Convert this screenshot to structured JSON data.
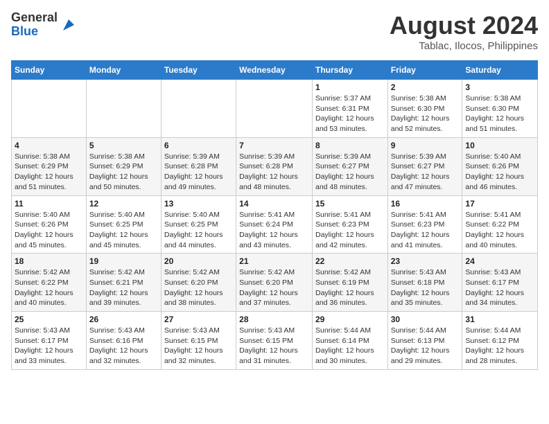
{
  "header": {
    "logo_general": "General",
    "logo_blue": "Blue",
    "month_title": "August 2024",
    "location": "Tablac, Ilocos, Philippines"
  },
  "days_of_week": [
    "Sunday",
    "Monday",
    "Tuesday",
    "Wednesday",
    "Thursday",
    "Friday",
    "Saturday"
  ],
  "weeks": [
    [
      {
        "day": "",
        "info": ""
      },
      {
        "day": "",
        "info": ""
      },
      {
        "day": "",
        "info": ""
      },
      {
        "day": "",
        "info": ""
      },
      {
        "day": "1",
        "info": "Sunrise: 5:37 AM\nSunset: 6:31 PM\nDaylight: 12 hours\nand 53 minutes."
      },
      {
        "day": "2",
        "info": "Sunrise: 5:38 AM\nSunset: 6:30 PM\nDaylight: 12 hours\nand 52 minutes."
      },
      {
        "day": "3",
        "info": "Sunrise: 5:38 AM\nSunset: 6:30 PM\nDaylight: 12 hours\nand 51 minutes."
      }
    ],
    [
      {
        "day": "4",
        "info": "Sunrise: 5:38 AM\nSunset: 6:29 PM\nDaylight: 12 hours\nand 51 minutes."
      },
      {
        "day": "5",
        "info": "Sunrise: 5:38 AM\nSunset: 6:29 PM\nDaylight: 12 hours\nand 50 minutes."
      },
      {
        "day": "6",
        "info": "Sunrise: 5:39 AM\nSunset: 6:28 PM\nDaylight: 12 hours\nand 49 minutes."
      },
      {
        "day": "7",
        "info": "Sunrise: 5:39 AM\nSunset: 6:28 PM\nDaylight: 12 hours\nand 48 minutes."
      },
      {
        "day": "8",
        "info": "Sunrise: 5:39 AM\nSunset: 6:27 PM\nDaylight: 12 hours\nand 48 minutes."
      },
      {
        "day": "9",
        "info": "Sunrise: 5:39 AM\nSunset: 6:27 PM\nDaylight: 12 hours\nand 47 minutes."
      },
      {
        "day": "10",
        "info": "Sunrise: 5:40 AM\nSunset: 6:26 PM\nDaylight: 12 hours\nand 46 minutes."
      }
    ],
    [
      {
        "day": "11",
        "info": "Sunrise: 5:40 AM\nSunset: 6:26 PM\nDaylight: 12 hours\nand 45 minutes."
      },
      {
        "day": "12",
        "info": "Sunrise: 5:40 AM\nSunset: 6:25 PM\nDaylight: 12 hours\nand 45 minutes."
      },
      {
        "day": "13",
        "info": "Sunrise: 5:40 AM\nSunset: 6:25 PM\nDaylight: 12 hours\nand 44 minutes."
      },
      {
        "day": "14",
        "info": "Sunrise: 5:41 AM\nSunset: 6:24 PM\nDaylight: 12 hours\nand 43 minutes."
      },
      {
        "day": "15",
        "info": "Sunrise: 5:41 AM\nSunset: 6:23 PM\nDaylight: 12 hours\nand 42 minutes."
      },
      {
        "day": "16",
        "info": "Sunrise: 5:41 AM\nSunset: 6:23 PM\nDaylight: 12 hours\nand 41 minutes."
      },
      {
        "day": "17",
        "info": "Sunrise: 5:41 AM\nSunset: 6:22 PM\nDaylight: 12 hours\nand 40 minutes."
      }
    ],
    [
      {
        "day": "18",
        "info": "Sunrise: 5:42 AM\nSunset: 6:22 PM\nDaylight: 12 hours\nand 40 minutes."
      },
      {
        "day": "19",
        "info": "Sunrise: 5:42 AM\nSunset: 6:21 PM\nDaylight: 12 hours\nand 39 minutes."
      },
      {
        "day": "20",
        "info": "Sunrise: 5:42 AM\nSunset: 6:20 PM\nDaylight: 12 hours\nand 38 minutes."
      },
      {
        "day": "21",
        "info": "Sunrise: 5:42 AM\nSunset: 6:20 PM\nDaylight: 12 hours\nand 37 minutes."
      },
      {
        "day": "22",
        "info": "Sunrise: 5:42 AM\nSunset: 6:19 PM\nDaylight: 12 hours\nand 36 minutes."
      },
      {
        "day": "23",
        "info": "Sunrise: 5:43 AM\nSunset: 6:18 PM\nDaylight: 12 hours\nand 35 minutes."
      },
      {
        "day": "24",
        "info": "Sunrise: 5:43 AM\nSunset: 6:17 PM\nDaylight: 12 hours\nand 34 minutes."
      }
    ],
    [
      {
        "day": "25",
        "info": "Sunrise: 5:43 AM\nSunset: 6:17 PM\nDaylight: 12 hours\nand 33 minutes."
      },
      {
        "day": "26",
        "info": "Sunrise: 5:43 AM\nSunset: 6:16 PM\nDaylight: 12 hours\nand 32 minutes."
      },
      {
        "day": "27",
        "info": "Sunrise: 5:43 AM\nSunset: 6:15 PM\nDaylight: 12 hours\nand 32 minutes."
      },
      {
        "day": "28",
        "info": "Sunrise: 5:43 AM\nSunset: 6:15 PM\nDaylight: 12 hours\nand 31 minutes."
      },
      {
        "day": "29",
        "info": "Sunrise: 5:44 AM\nSunset: 6:14 PM\nDaylight: 12 hours\nand 30 minutes."
      },
      {
        "day": "30",
        "info": "Sunrise: 5:44 AM\nSunset: 6:13 PM\nDaylight: 12 hours\nand 29 minutes."
      },
      {
        "day": "31",
        "info": "Sunrise: 5:44 AM\nSunset: 6:12 PM\nDaylight: 12 hours\nand 28 minutes."
      }
    ]
  ]
}
